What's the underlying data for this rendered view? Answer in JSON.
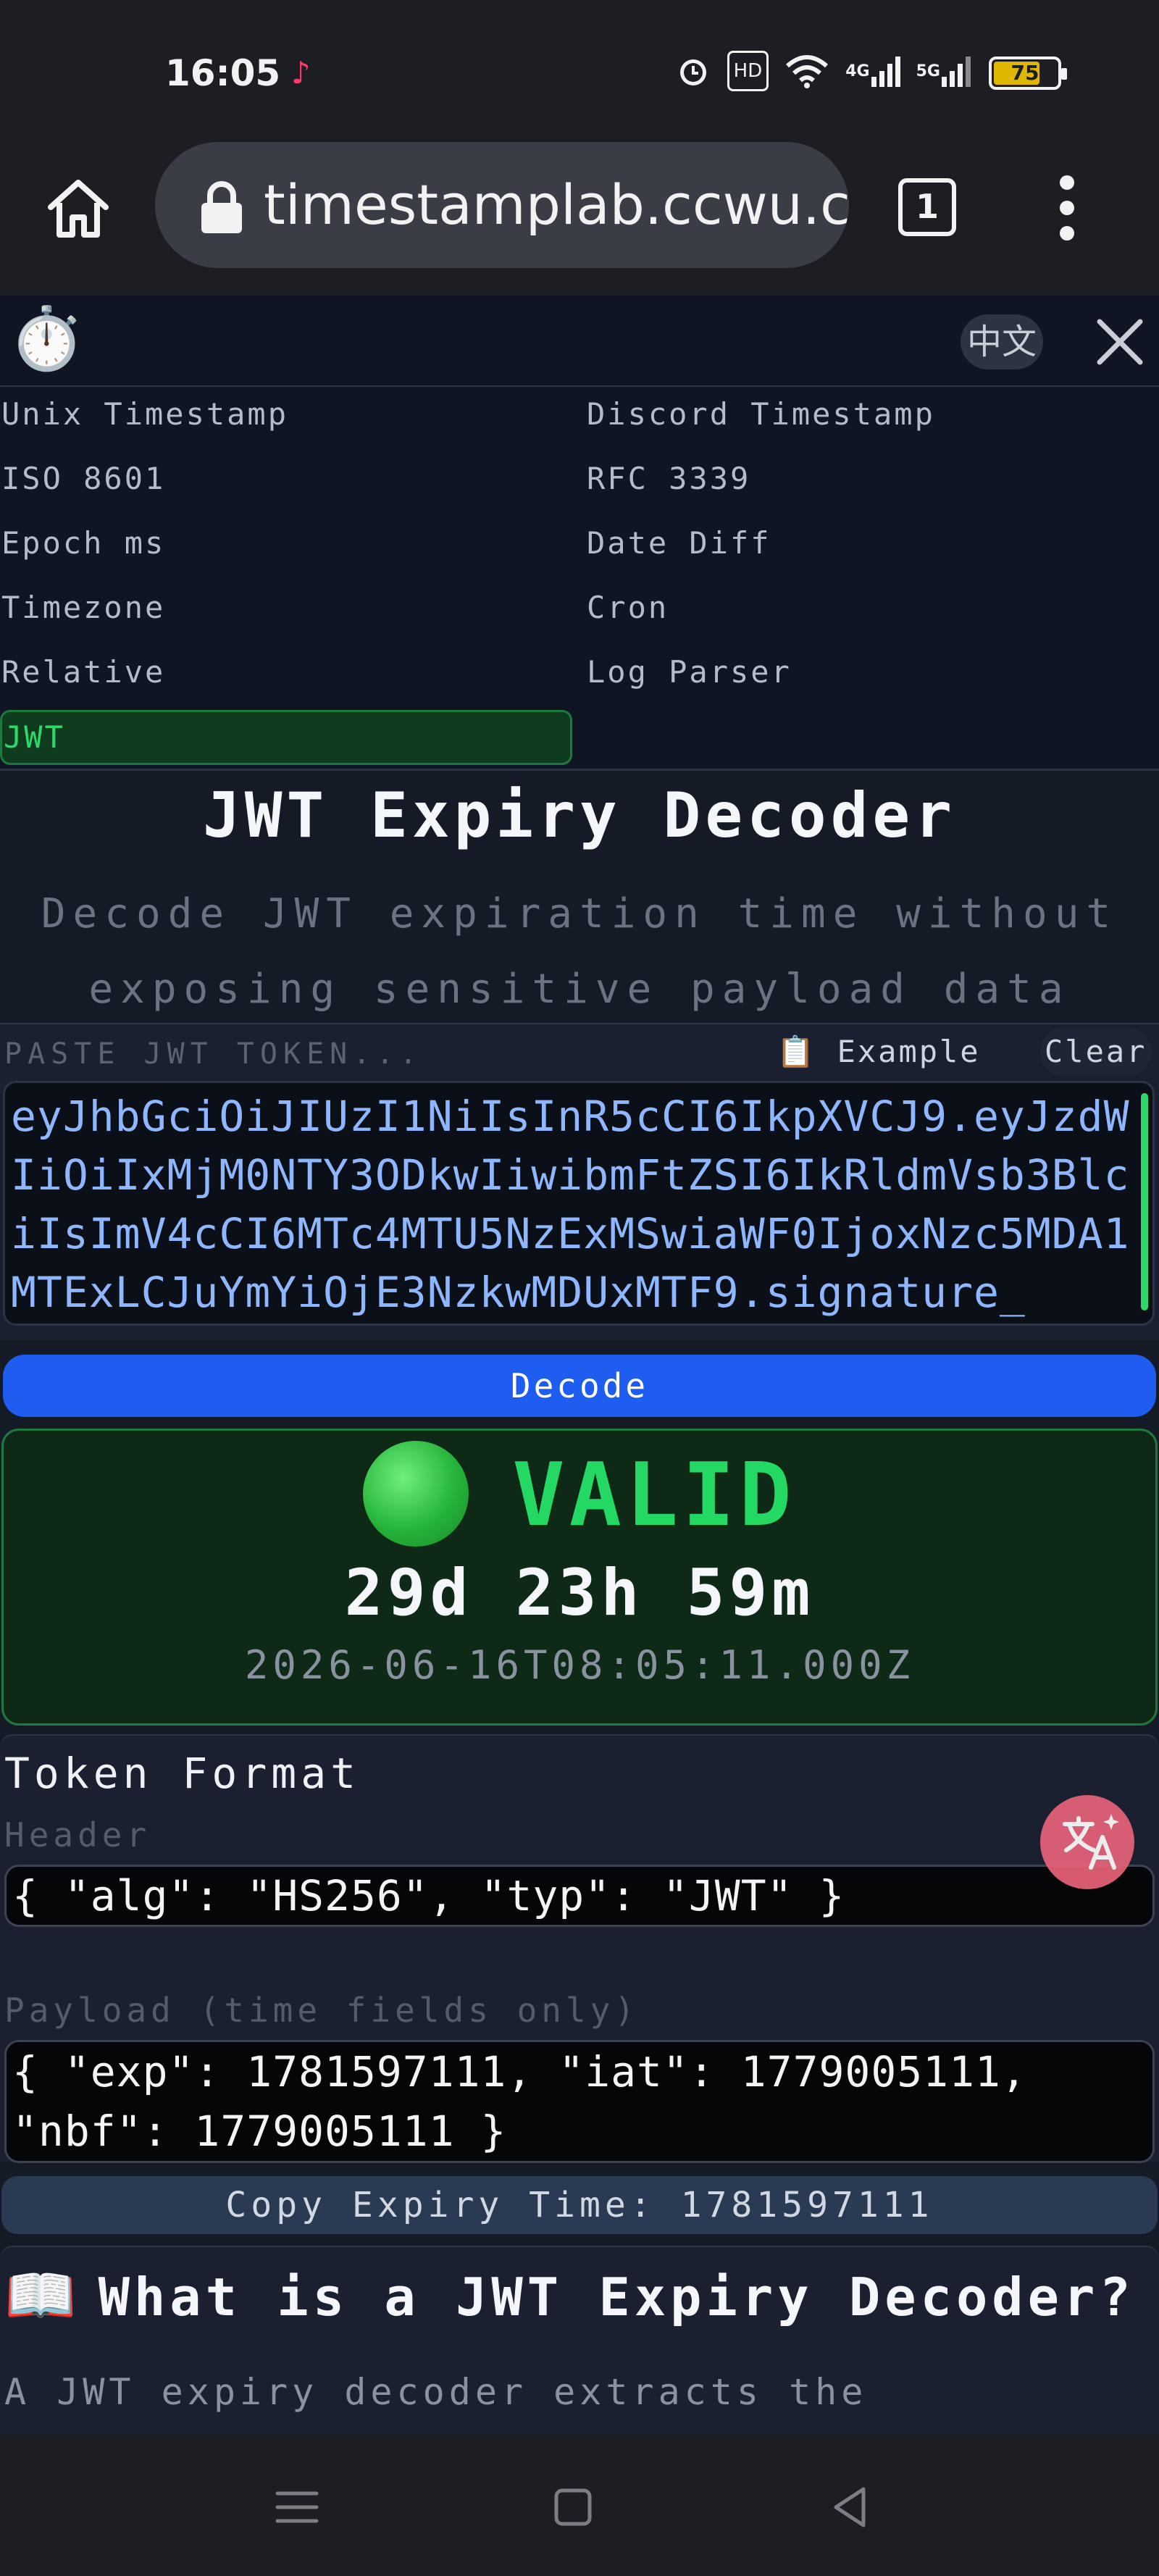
{
  "status_bar": {
    "time": "16:05",
    "battery": "75",
    "network_badge": "HD",
    "signal_1": "4G",
    "signal_2": "5G",
    "icons": [
      "tiktok-icon",
      "alarm-icon",
      "hd-icon",
      "wifi-icon",
      "signal-icon",
      "battery-icon"
    ]
  },
  "browser": {
    "url": "timestamplab.ccwu.cc",
    "tab_count": "1",
    "icons": [
      "home-icon",
      "lock-icon",
      "tabs-icon",
      "menu-icon"
    ]
  },
  "app_header": {
    "logo_emoji": "⏱️",
    "lang_button": "中文",
    "close_glyph": "✕"
  },
  "nav": {
    "left": [
      "Unix Timestamp",
      "ISO 8601",
      "Epoch ms",
      "Timezone",
      "Relative",
      "JWT"
    ],
    "right": [
      "Discord Timestamp",
      "RFC 3339",
      "Date Diff",
      "Cron",
      "Log Parser"
    ],
    "active": "JWT"
  },
  "tool": {
    "title": "JWT Expiry Decoder",
    "subtitle": "Decode JWT expiration time without exposing sensitive payload data"
  },
  "input": {
    "label": "PASTE JWT TOKEN...",
    "example_button": "📋 Example",
    "clear_button": "Clear",
    "token": "eyJhbGciOiJIUzI1NiIsInR5cCI6IkpXVCJ9.eyJzdWIiOiIxMjM0NTY3ODkwIiwibmFtZSI6IkRldmVsb3BlciIsImV4cCI6MTc4MTU5NzExMSwiaWF0IjoxNzc5MDA1MTExLCJuYmYiOjE3NzkwMDUxMTF9.signature_"
  },
  "decode_button": "Decode",
  "result": {
    "status": "VALID",
    "status_color": "#23d964",
    "remaining": "29d 23h 59m",
    "expiry": "2026-06-16T08:05:11.000Z"
  },
  "format": {
    "title": "Token Format",
    "header_label": "Header",
    "header_value": "{ \"alg\": \"HS256\", \"typ\": \"JWT\" }",
    "payload_label": "Payload (time fields only)",
    "payload_value": "{ \"exp\": 1781597111, \"iat\": 1779005111, \"nbf\": 1779005111 }"
  },
  "copy_button": "Copy Expiry Time: 1781597111",
  "about": {
    "icon": "📖",
    "title": "What is a JWT Expiry Decoder?",
    "text": "A JWT expiry decoder extracts the"
  },
  "system_nav": [
    "menu-nav-icon",
    "home-nav-icon",
    "back-nav-icon"
  ]
}
